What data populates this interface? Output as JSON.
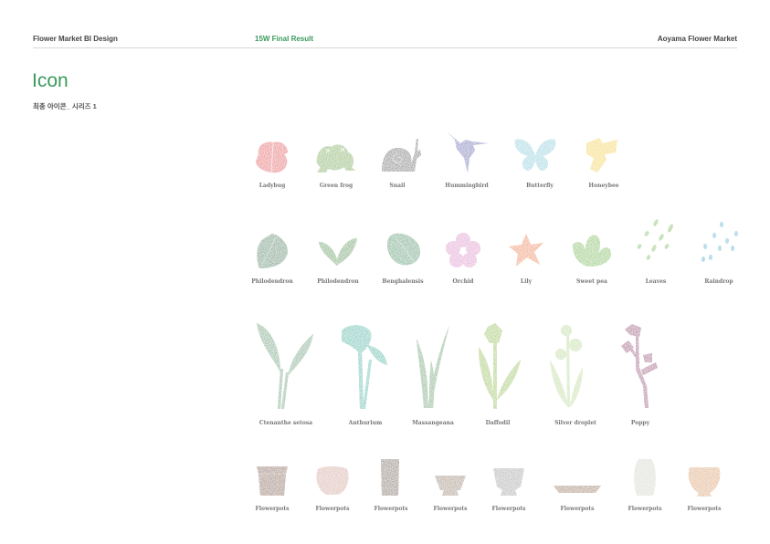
{
  "header": {
    "left": "Flower Market BI  Design",
    "center": "15W   Final Result",
    "right": "Aoyama Flower Market"
  },
  "title": "Icon",
  "subtitle": "최종 아이콘_ 시리즈 1",
  "rows": [
    {
      "items": [
        {
          "label": "Ladybug",
          "icon": "ladybug-icon",
          "color": "#e8474f"
        },
        {
          "label": "Green frog",
          "icon": "frog-icon",
          "color": "#7ab33a"
        },
        {
          "label": "Snail",
          "icon": "snail-icon",
          "color": "#6b6b6b"
        },
        {
          "label": "Hummingbird",
          "icon": "hummingbird-icon",
          "color": "#6466b8"
        },
        {
          "label": "Butterfly",
          "icon": "butterfly-icon",
          "color": "#8fd3df"
        },
        {
          "label": "Honeybee",
          "icon": "honeybee-icon",
          "color": "#f5d820"
        }
      ]
    },
    {
      "items": [
        {
          "label": "Philodendron",
          "icon": "philodendron-leaf-icon",
          "color": "#3d8a62"
        },
        {
          "label": "Philodendron",
          "icon": "philodendron-sprout-icon",
          "color": "#4fa248"
        },
        {
          "label": "Benghalensis",
          "icon": "benghalensis-leaf-icon",
          "color": "#3ea06a"
        },
        {
          "label": "Orchid",
          "icon": "orchid-icon",
          "color": "#e29bd0"
        },
        {
          "label": "Lily",
          "icon": "lily-icon",
          "color": "#f08a3c"
        },
        {
          "label": "Sweet pea",
          "icon": "sweet-pea-icon",
          "color": "#7cc240"
        },
        {
          "label": "Leaves",
          "icon": "leaves-icon",
          "color": "#7cc240"
        },
        {
          "label": "Raindrop",
          "icon": "raindrop-icon",
          "color": "#3cb8d8"
        }
      ]
    },
    {
      "items": [
        {
          "label": "Ctenanthe setosa",
          "icon": "ctenanthe-icon",
          "color": "#6aaa80"
        },
        {
          "label": "Anthurium",
          "icon": "anthurium-icon",
          "color": "#20bfae"
        },
        {
          "label": "Massangeana",
          "icon": "massangeana-icon",
          "color": "#6aaa70"
        },
        {
          "label": "Daffodil",
          "icon": "daffodil-icon",
          "color": "#9cc83a"
        },
        {
          "label": "Silver droplet",
          "icon": "silver-droplet-icon",
          "color": "#c2dea0"
        },
        {
          "label": "Poppy",
          "icon": "poppy-icon",
          "color": "#a0307a"
        }
      ]
    },
    {
      "items": [
        {
          "label": "Flowerpots",
          "icon": "flowerpot-bucket-icon",
          "color": "#8a5a3a"
        },
        {
          "label": "Flowerpots",
          "icon": "flowerpot-round-icon",
          "color": "#d8aea4"
        },
        {
          "label": "Flowerpots",
          "icon": "flowerpot-tall-icon",
          "color": "#7a6450"
        },
        {
          "label": "Flowerpots",
          "icon": "flowerpot-bowl-icon",
          "color": "#a08870"
        },
        {
          "label": "Flowerpots",
          "icon": "flowerpot-cup-icon",
          "color": "#a8a8a8"
        },
        {
          "label": "Flowerpots",
          "icon": "flowerpot-tray-icon",
          "color": "#a07a50"
        },
        {
          "label": "Flowerpots",
          "icon": "flowerpot-vase-icon",
          "color": "#d8d8d0"
        },
        {
          "label": "Flowerpots",
          "icon": "flowerpot-urn-icon",
          "color": "#e0a868"
        }
      ]
    }
  ]
}
